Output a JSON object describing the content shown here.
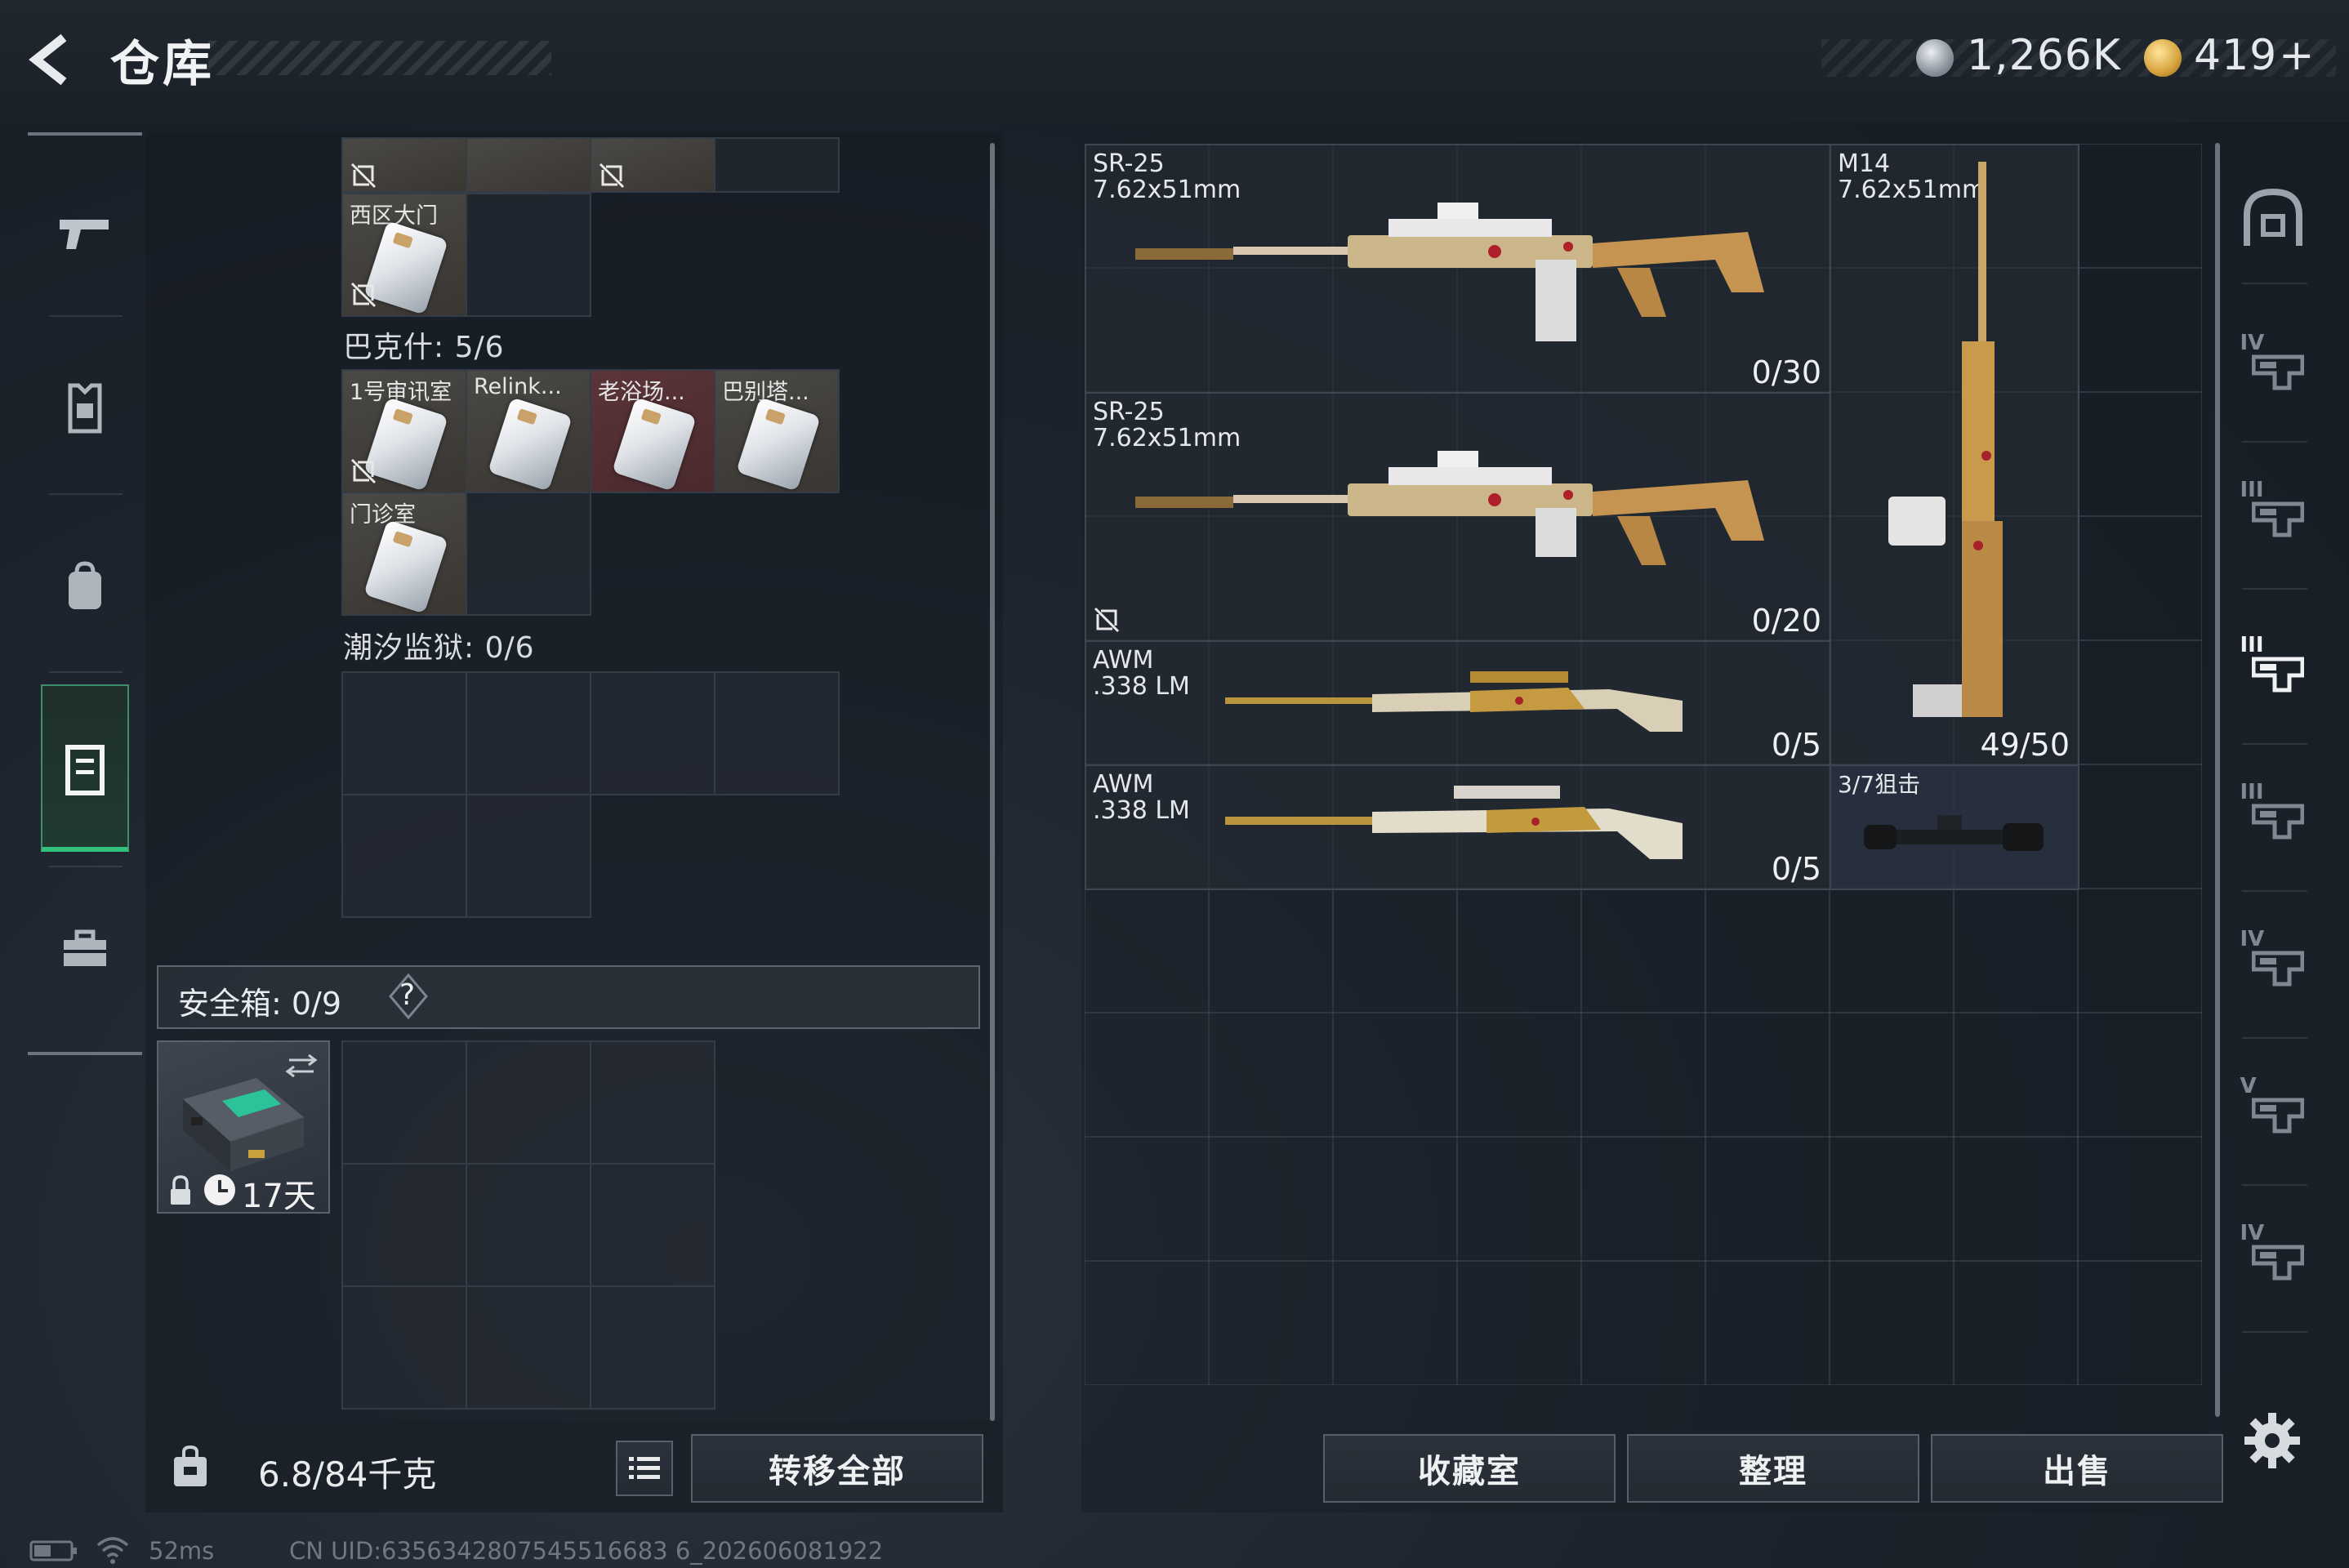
{
  "header": {
    "title": "仓库"
  },
  "currency": {
    "silver": {
      "value": "1,266K",
      "icon": "silver-coin-icon"
    },
    "gold": {
      "value": "419",
      "plus": "+",
      "icon": "gold-coin-icon"
    }
  },
  "left_nav": {
    "items": [
      {
        "icon": "pistol-icon"
      },
      {
        "icon": "chest-rig-icon"
      },
      {
        "icon": "backpack-icon"
      },
      {
        "icon": "locker-icon",
        "active": true
      },
      {
        "icon": "toolbox-icon"
      }
    ]
  },
  "stash": {
    "group_west_gate": {
      "item_label": "西区大门"
    },
    "bakesh": {
      "title": "巴克什: 5/6",
      "items": [
        "1号审讯室",
        "Relink...",
        "老浴场...",
        "巴别塔...",
        "门诊室"
      ]
    },
    "tidal_prison": {
      "title": "潮汐监狱: 0/6"
    }
  },
  "safe_box": {
    "label": "安全箱: 0/9",
    "help": "?",
    "days": "17天"
  },
  "bottom_left": {
    "weight": "6.8/84千克",
    "transfer_all": "转移全部"
  },
  "weapons": [
    {
      "name": "SR-25",
      "caliber": "7.62x51mm",
      "ammo": "0/30"
    },
    {
      "name": "SR-25",
      "caliber": "7.62x51mm",
      "ammo": "0/20"
    },
    {
      "name": "AWM",
      "caliber": ".338 LM",
      "ammo": "0/5"
    },
    {
      "name": "AWM",
      "caliber": ".338 LM",
      "ammo": "0/5"
    },
    {
      "name": "M14",
      "caliber": "7.62x51mm",
      "ammo": "49/50"
    },
    {
      "name": "3/7狙击"
    }
  ],
  "bottom_right": {
    "collection": "收藏室",
    "organize": "整理",
    "sell": "出售"
  },
  "right_column": {
    "tiers": [
      "IV",
      "III",
      "III",
      "III",
      "IV",
      "V",
      "IV"
    ]
  },
  "status_bar": {
    "ping": "52ms",
    "uid": "CN UID:6356342807545516683 6_202606081922"
  },
  "colors": {
    "accent_green": "#33c07d",
    "item_red": "#5a3438"
  }
}
